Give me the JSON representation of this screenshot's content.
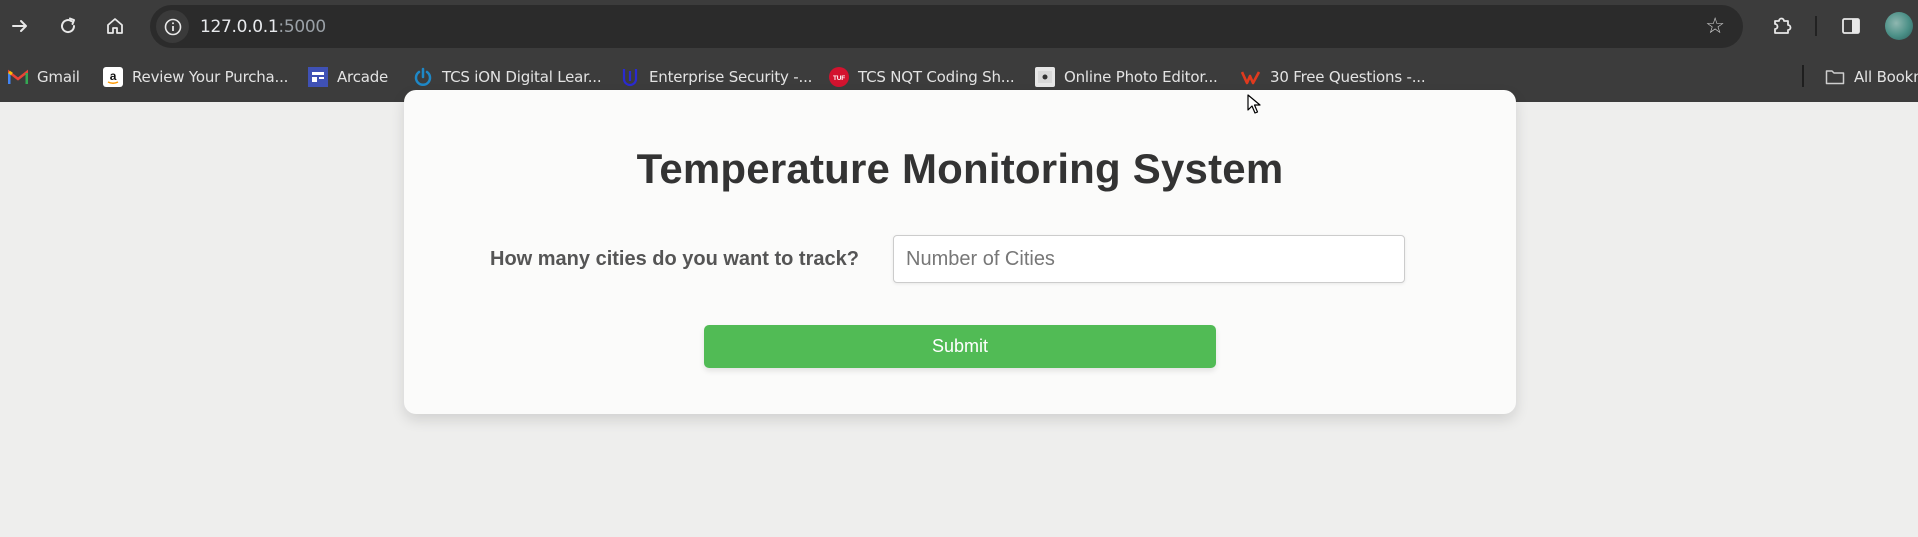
{
  "browser": {
    "url_host": "127.0.0.1",
    "url_port": ":5000",
    "bookmarks": [
      {
        "label": "Gmail",
        "icon": "gmail-icon"
      },
      {
        "label": "Review Your Purcha...",
        "icon": "amazon-icon"
      },
      {
        "label": "Arcade",
        "icon": "arcade-icon"
      },
      {
        "label": "TCS iON Digital Lear...",
        "icon": "power-icon"
      },
      {
        "label": "Enterprise Security -...",
        "icon": "udacity-icon"
      },
      {
        "label": "TCS NQT Coding Sh...",
        "icon": "tuf-icon"
      },
      {
        "label": "Online Photo Editor...",
        "icon": "photo-icon"
      },
      {
        "label": "30 Free Questions -...",
        "icon": "w-logo-icon"
      }
    ],
    "all_bookmarks_label": "All Bookm"
  },
  "page": {
    "title": "Temperature Monitoring System",
    "cities_label": "How many cities do you want to track?",
    "cities_input": {
      "value": "",
      "placeholder": "Number of Cities"
    },
    "submit_label": "Submit"
  },
  "colors": {
    "accent": "#51bb55",
    "title": "#333333",
    "background": "#eeeeed"
  }
}
